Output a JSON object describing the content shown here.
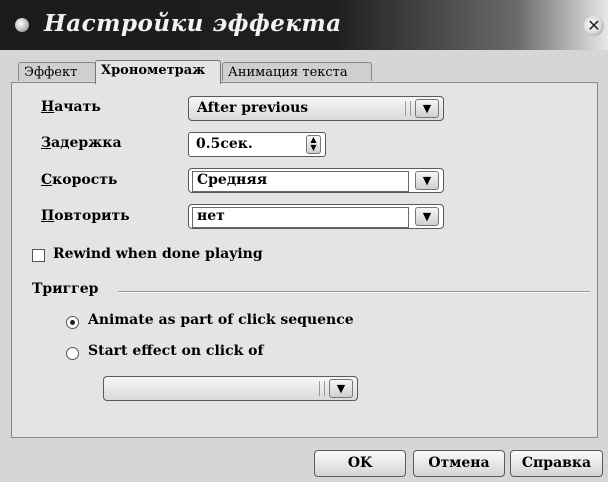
{
  "window": {
    "title": "Настройки эффекта"
  },
  "tabs": [
    {
      "label": "Эффект"
    },
    {
      "label": "Хронометраж"
    },
    {
      "label": "Анимация текста"
    }
  ],
  "timing": {
    "start": {
      "label": "Начать",
      "value": "After previous"
    },
    "delay": {
      "label": "Задержка",
      "value": "0.5сек."
    },
    "speed": {
      "label": "Скорость",
      "value": "Средняя"
    },
    "repeat": {
      "label": "Повторить",
      "value": "нет"
    },
    "rewind": {
      "label": "Rewind when done playing",
      "checked": false
    }
  },
  "trigger": {
    "group_label": "Триггер",
    "option_sequence": {
      "label": "Animate as part of click sequence",
      "selected": true
    },
    "option_click": {
      "label": "Start effect on click of",
      "selected": false
    },
    "shape_select": {
      "value": ""
    }
  },
  "buttons": {
    "ok": "OK",
    "cancel": "Отмена",
    "help": "Справка"
  },
  "icons": {
    "combo_arrow": "combo-arrow-icon",
    "spin": "spin-updown-icon"
  }
}
